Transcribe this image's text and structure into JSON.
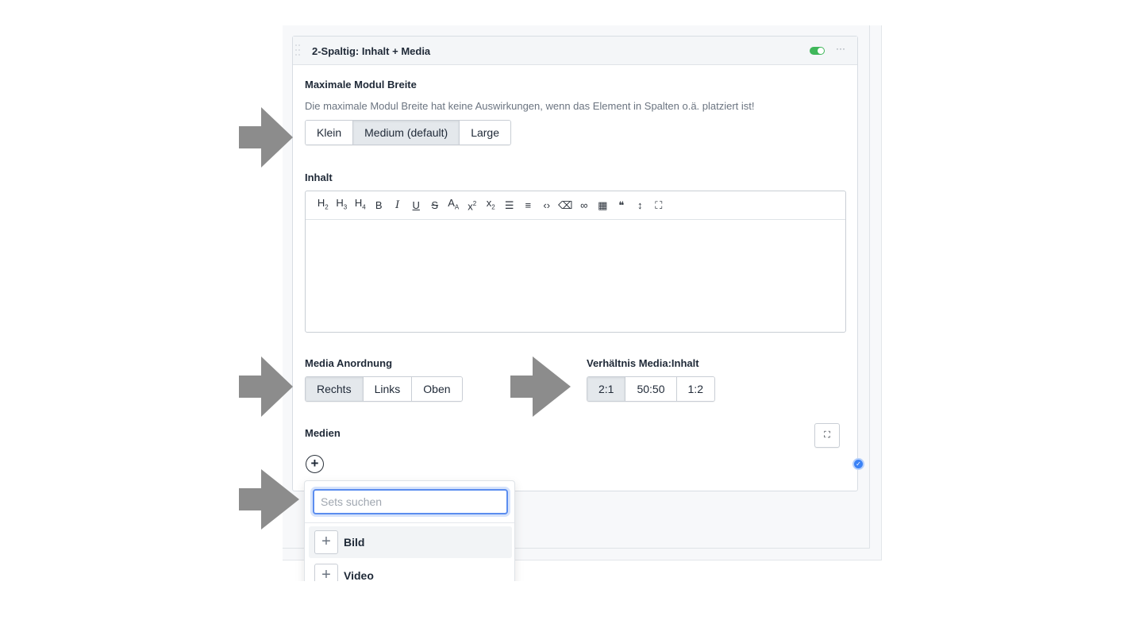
{
  "set": {
    "title": "2-Spaltig: Inhalt + Media",
    "enabled": true,
    "menu_icon": "more-dots-icon"
  },
  "module_width": {
    "label": "Maximale Modul Breite",
    "help": "Die maximale Modul Breite hat keine Auswirkungen, wenn das Element in Spalten o.ä. platziert ist!",
    "options": [
      "Klein",
      "Medium (default)",
      "Large"
    ],
    "selected": "Medium (default)"
  },
  "content": {
    "label": "Inhalt",
    "toolbar": [
      "H2",
      "H3",
      "H4",
      "B",
      "I",
      "U",
      "S",
      "Aa",
      "x²",
      "x₂",
      "• list",
      "1. list",
      "<>",
      "eraser",
      "link",
      "table",
      "quote",
      "line-height",
      "fullscreen"
    ],
    "value": ""
  },
  "media_arrangement": {
    "label": "Media Anordnung",
    "options": [
      "Rechts",
      "Links",
      "Oben"
    ],
    "selected": "Rechts"
  },
  "ratio": {
    "label": "Verhältnis Media:Inhalt",
    "options": [
      "2:1",
      "50:50",
      "1:2"
    ],
    "selected": "2:1"
  },
  "media": {
    "label": "Medien",
    "add_icon": "plus-circle-icon",
    "expand_icon": "expand-icon"
  },
  "set_picker": {
    "search_placeholder": "Sets suchen",
    "items": [
      "Bild",
      "Video"
    ]
  },
  "colors": {
    "accent": "#5b8def",
    "toggle_on": "#3fb75a",
    "arrow": "#8c8c8c"
  }
}
